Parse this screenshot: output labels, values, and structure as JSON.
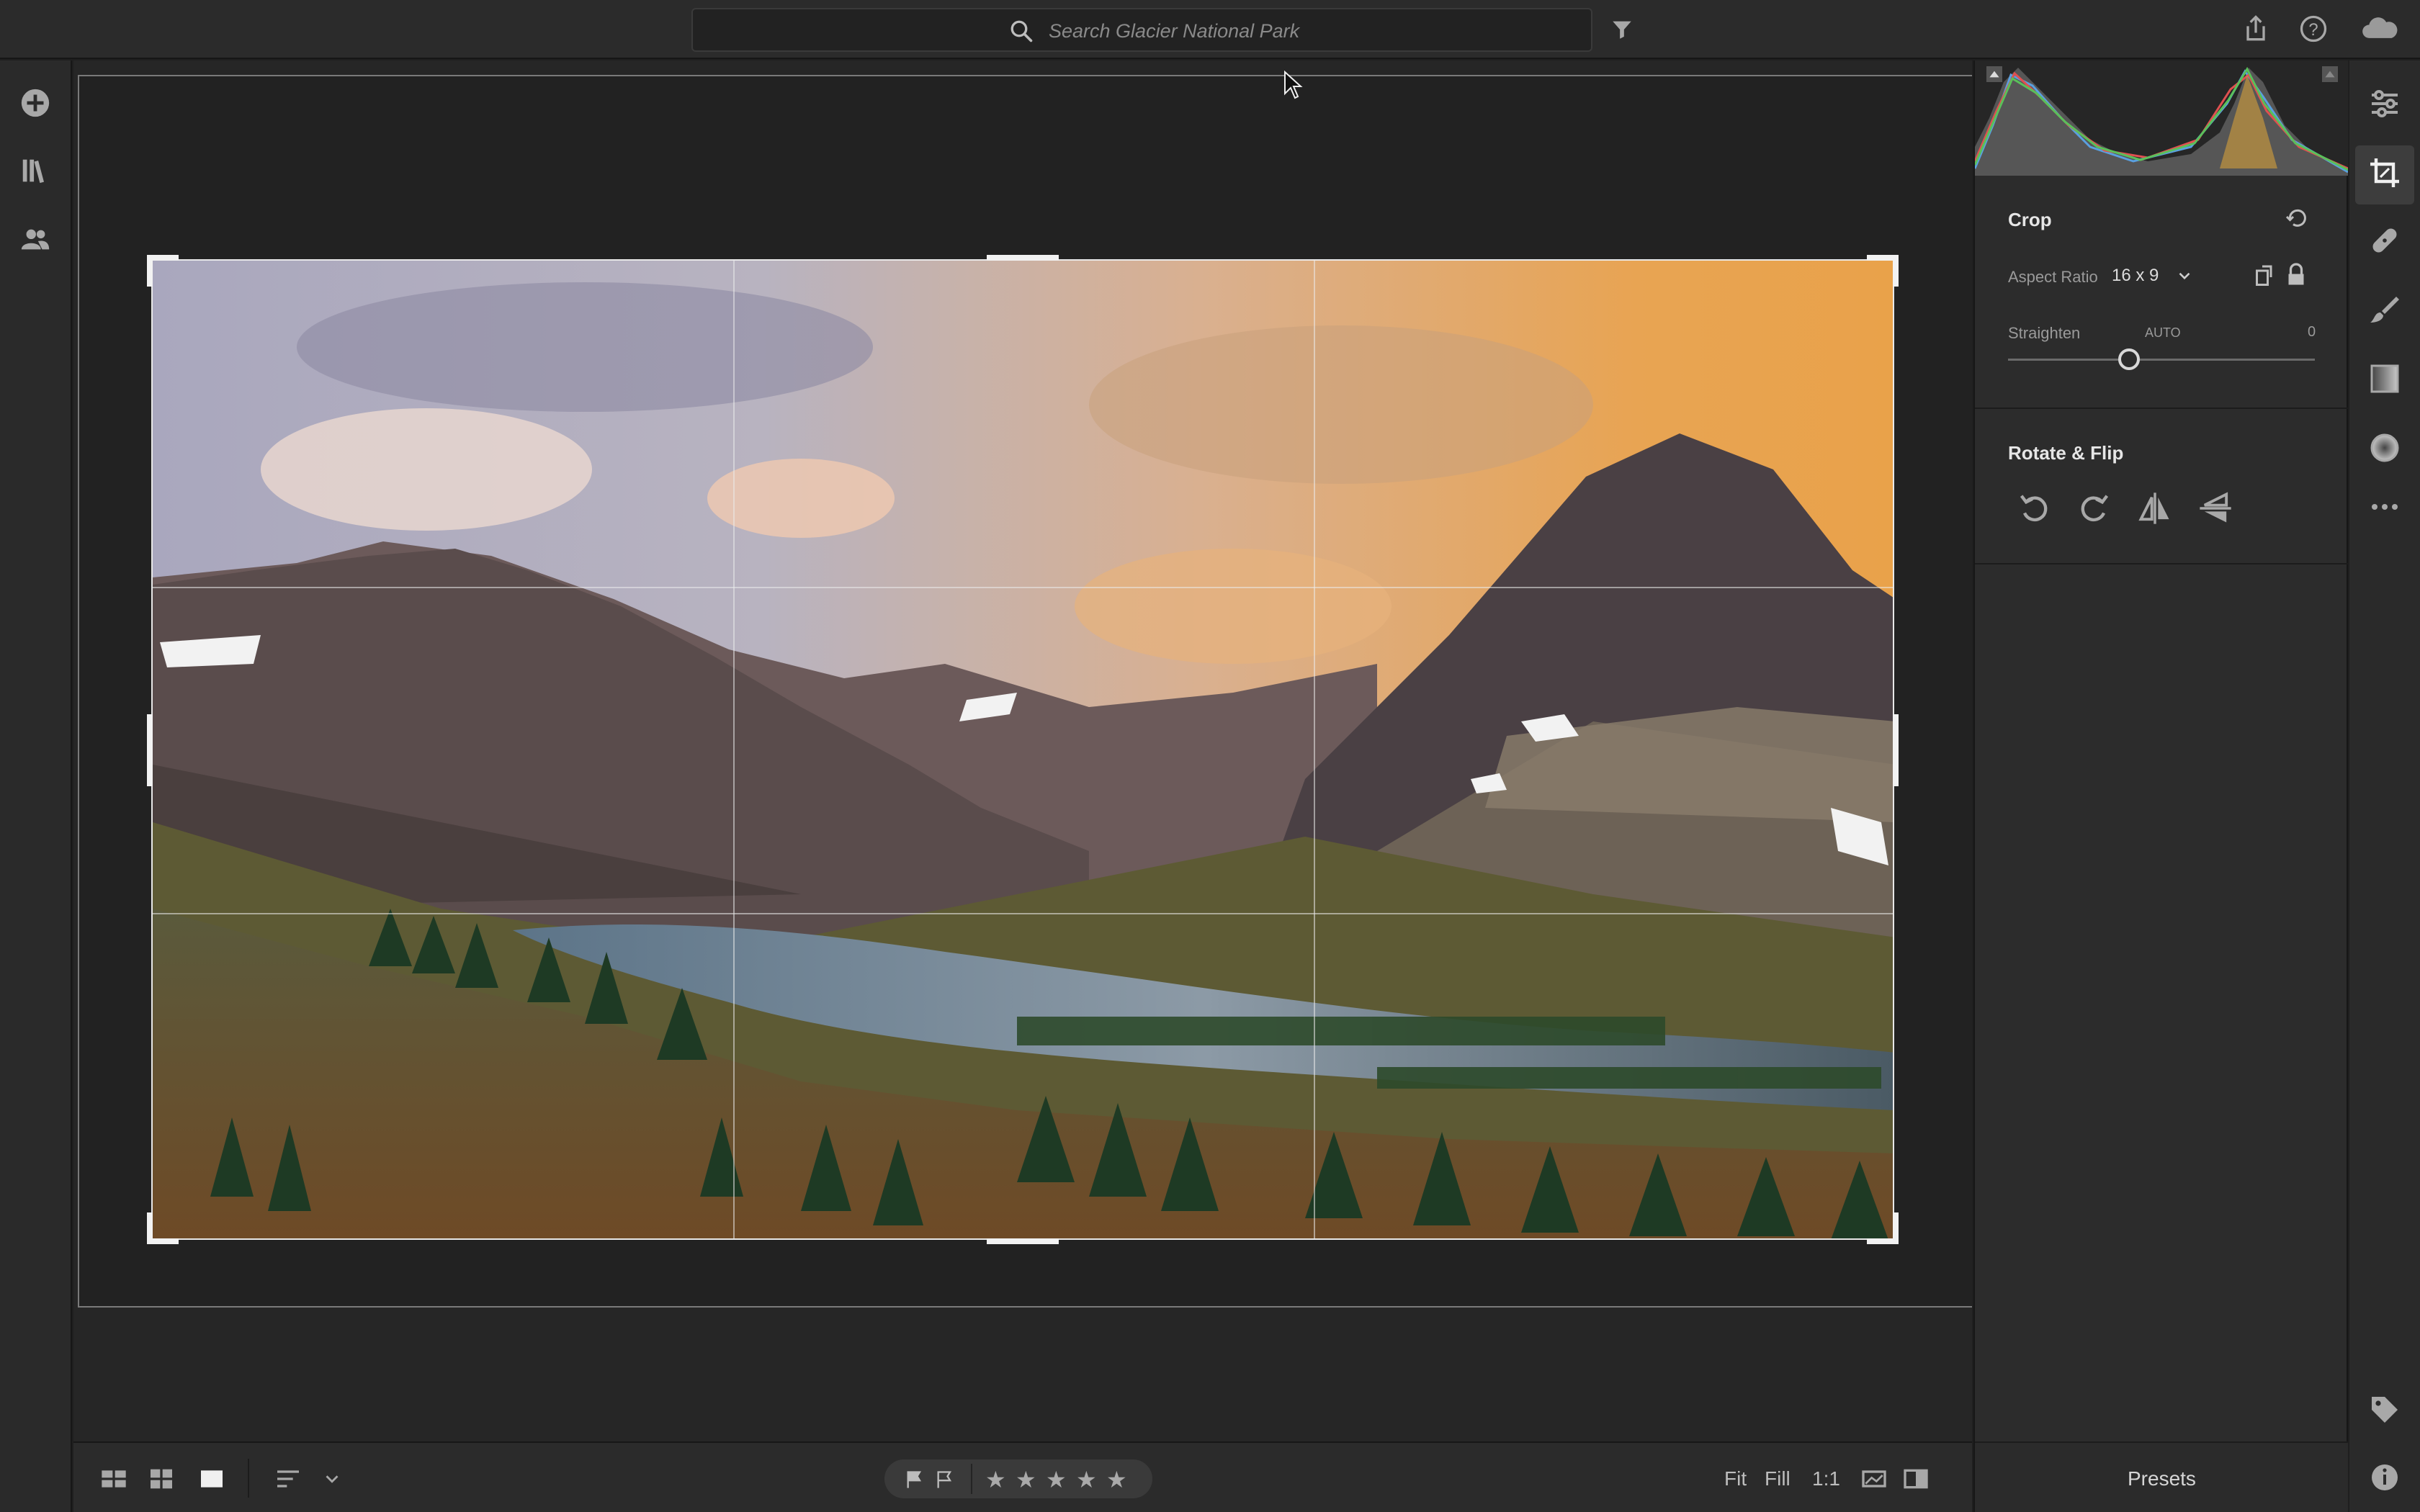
{
  "search": {
    "placeholder": "Search Glacier National Park"
  },
  "crop_panel": {
    "title": "Crop",
    "aspect_ratio_label": "Aspect Ratio",
    "aspect_ratio_value": "16 x 9",
    "straighten_label": "Straighten",
    "straighten_auto": "AUTO",
    "straighten_value": "0"
  },
  "rotate_panel": {
    "title": "Rotate & Flip"
  },
  "bottom": {
    "zoom_fit": "Fit",
    "zoom_fill": "Fill",
    "zoom_1to1": "1:1",
    "stars": [
      "★",
      "★",
      "★",
      "★",
      "★"
    ]
  },
  "presets": {
    "label": "Presets"
  },
  "icons": {
    "top_right": [
      "share-icon",
      "help-icon",
      "cloud-icon"
    ],
    "left": [
      "add-photos-icon",
      "library-icon",
      "people-icon"
    ],
    "tools": [
      "edit-sliders-icon",
      "crop-icon",
      "healing-icon",
      "brush-icon",
      "linear-gradient-icon",
      "radial-gradient-icon",
      "more-icon",
      "tag-icon",
      "info-icon"
    ]
  },
  "colors": {
    "accent": "#ffffff",
    "panel": "#2c2c2c",
    "background": "#1f1f1f"
  }
}
